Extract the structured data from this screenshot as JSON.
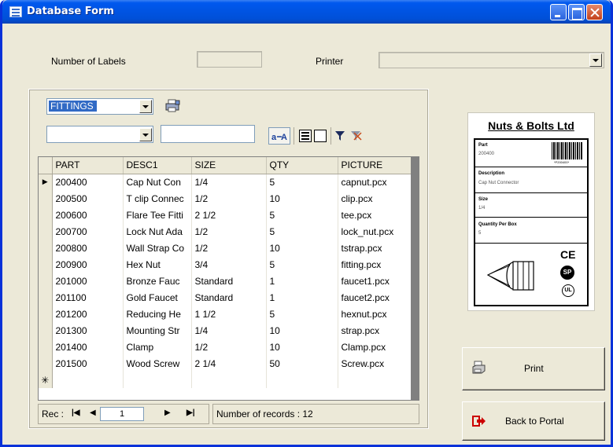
{
  "window": {
    "title": "Database Form"
  },
  "settings": {
    "labels_caption": "Number of Labels",
    "labels_value": "",
    "printer_caption": "Printer",
    "printer_value": ""
  },
  "filter": {
    "table_selected": "FITTINGS",
    "field_selected": "",
    "search_value": ""
  },
  "grid": {
    "columns": [
      "PART",
      "DESC1",
      "SIZE",
      "QTY",
      "PICTURE"
    ],
    "rows": [
      [
        "200400",
        "Cap Nut Con",
        "1/4",
        "5",
        "capnut.pcx"
      ],
      [
        "200500",
        "T clip Connec",
        "1/2",
        "10",
        "clip.pcx"
      ],
      [
        "200600",
        "Flare Tee Fitti",
        "2 1/2",
        "5",
        "tee.pcx"
      ],
      [
        "200700",
        "Lock Nut Ada",
        "1/2",
        "5",
        "lock_nut.pcx"
      ],
      [
        "200800",
        "Wall Strap Co",
        "1/2",
        "10",
        "tstrap.pcx"
      ],
      [
        "200900",
        "Hex Nut",
        "3/4",
        "5",
        "fitting.pcx"
      ],
      [
        "201000",
        "Bronze Fauc",
        "Standard",
        "1",
        "faucet1.pcx"
      ],
      [
        "201100",
        "Gold Faucet",
        "Standard",
        "1",
        "faucet2.pcx"
      ],
      [
        "201200",
        "Reducing He",
        "1 1/2",
        "5",
        "hexnut.pcx"
      ],
      [
        "201300",
        "Mounting Str",
        "1/4",
        "10",
        "strap.pcx"
      ],
      [
        "201400",
        "Clamp",
        "1/2",
        "10",
        "Clamp.pcx"
      ],
      [
        "201500",
        "Wood Screw",
        "2 1/4",
        "50",
        "Screw.pcx"
      ]
    ],
    "new_row_marker": "✳",
    "current_row_marker": "▶"
  },
  "navigator": {
    "rec_label": "Rec :",
    "rec_value": "1",
    "records_text": "Number of records : 12"
  },
  "label_preview": {
    "company": "Nuts & Bolts Ltd",
    "part_caption": "Part",
    "part_value": "200400",
    "barcode_text": "*P200400*",
    "desc_caption": "Description",
    "desc_value": "Cap Nut Connector",
    "size_caption": "Size",
    "size_value": "1/4",
    "qty_caption": "Quantity Per Box",
    "qty_value": "5",
    "ce_mark": "CE",
    "csa_mark": "SP",
    "ul_mark": "UL"
  },
  "buttons": {
    "print": "Print",
    "back": "Back to Portal"
  },
  "colors": {
    "titlebar": "#0054e3",
    "window_bg": "#ece9d8",
    "selection": "#316ac5",
    "back_icon": "#cc0000"
  },
  "icons": {
    "window": "form-icon",
    "printer_small": "printer-icon",
    "sort": "sort-az-icon",
    "filter": "filter-icon",
    "filter_clear": "filter-clear-icon"
  }
}
